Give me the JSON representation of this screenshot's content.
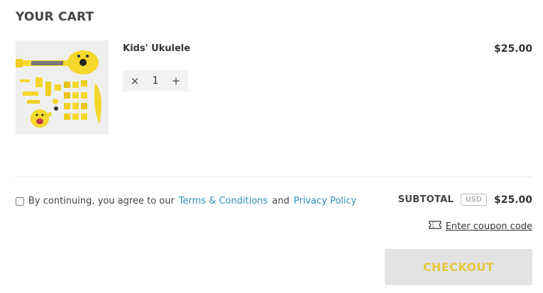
{
  "cart": {
    "title": "YOUR CART",
    "item": {
      "name": "Kids' Ukulele",
      "price": "$25.00",
      "quantity": "1",
      "decrement_icon": "close-x-icon",
      "increment_icon": "plus-icon"
    }
  },
  "terms": {
    "prefix": "By continuing, you agree to our",
    "terms_link": "Terms & Conditions",
    "and": "and",
    "privacy_link": "Privacy Policy"
  },
  "summary": {
    "subtotal_label": "SUBTOTAL",
    "currency": "USD",
    "subtotal_value": "$25.00",
    "coupon_label": "Enter coupon code",
    "coupon_icon": "ticket-icon",
    "checkout_label": "CHECKOUT"
  },
  "colors": {
    "link": "#2c8fbf",
    "checkout_text": "#e5c840",
    "checkout_bg": "#e3e3e3",
    "product_yellow": "#f4d82c"
  }
}
